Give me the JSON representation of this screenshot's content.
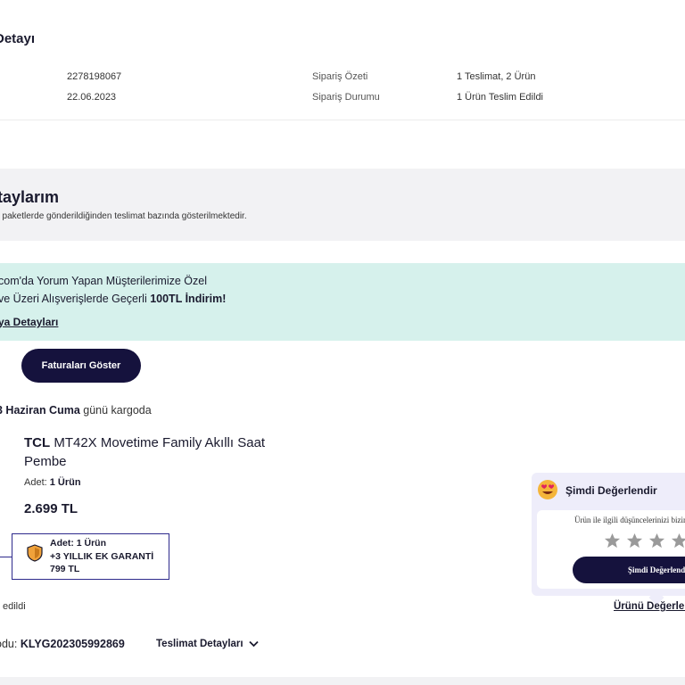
{
  "order": {
    "title": "Detayı",
    "number": "2278198067",
    "date": "22.06.2023",
    "summary_label": "Sipariş Özeti",
    "summary_value": "1 Teslimat, 2 Ürün",
    "status_label": "Sipariş Durumu",
    "status_value": "1 Ürün Teslim Edildi"
  },
  "delivery": {
    "title": "taylarım",
    "subtitle": "ı paketlerde gönderildiğinden teslimat bazında gösterilmektedir."
  },
  "promo": {
    "line1": "com'da Yorum Yapan Müşterilerimize Özel",
    "line2_prefix": "ve Üzeri Alışverişlerde Geçerli ",
    "line2_amount": "100TL",
    "line2_suffix": " İndirim!",
    "link": "ya Detayları"
  },
  "invoice_button": "Faturaları Göster",
  "cargo": {
    "date_bold": "3 Haziran Cuma",
    "date_suffix": " günü kargoda"
  },
  "product": {
    "brand": "TCL",
    "name": " MT42X Movetime Family Akıllı Saat Pembe",
    "qty_label": "Adet: ",
    "qty_value": "1 Ürün",
    "price": "2.699 TL"
  },
  "warranty": {
    "qty": "Adet: 1 Ürün",
    "title": "+3 YILLIK EK GARANTİ",
    "price": "799 TL"
  },
  "delivered_text": "edildi",
  "tracking": {
    "label": "odu: ",
    "code": "KLYG202305992869",
    "details_link": "Teslimat Detayları"
  },
  "rating": {
    "title": "Şimdi Değerlendir",
    "prompt": "Ürün ile ilgili düşüncelerinizi bizimle",
    "button": "Şimdi Değerlendir",
    "link": "Ürünü Değerlen"
  },
  "icons": {
    "shield": "shield-icon",
    "emoji": "heart-eyes-emoji-icon",
    "star": "star-icon",
    "chevron": "chevron-down-icon"
  },
  "colors": {
    "primary": "#15123d",
    "promo_bg": "#d6f1ec",
    "shield": "#f0a23a",
    "star": "#9a9a9a"
  }
}
